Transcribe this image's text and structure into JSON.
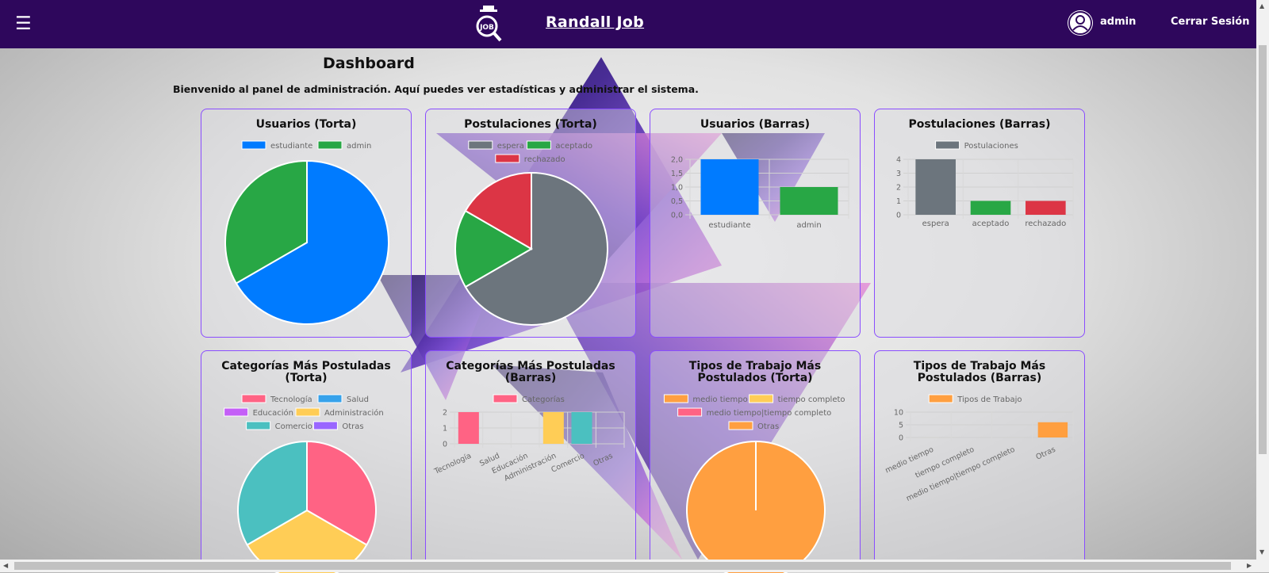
{
  "header": {
    "menu_glyph": "☰",
    "logo_text": "JOB",
    "brand": "Randall Job",
    "user": "admin",
    "logout": "Cerrar Sesión"
  },
  "page": {
    "title": "Dashboard",
    "welcome": "Bienvenido al panel de administración. Aquí puedes ver estadísticas y administrar el sistema."
  },
  "colors": {
    "nav": "#2e075c",
    "blue": "#007bff",
    "green": "#28a745",
    "gray": "#6c757d",
    "red": "#dc3545",
    "pink": "#ff6384",
    "skyblue": "#36a2eb",
    "purple": "#c45ff7",
    "yellow": "#ffcd56",
    "teal": "#4bc0c0",
    "violet": "#9966ff",
    "orange": "#ff9f40"
  },
  "chart_data": [
    {
      "id": "usuarios-torta",
      "title": "Usuarios (Torta)",
      "type": "pie",
      "categories": [
        "estudiante",
        "admin"
      ],
      "values": [
        2,
        1
      ],
      "colors": [
        "#007bff",
        "#28a745"
      ]
    },
    {
      "id": "postulaciones-torta",
      "title": "Postulaciones (Torta)",
      "type": "pie",
      "categories": [
        "espera",
        "aceptado",
        "rechazado"
      ],
      "values": [
        4,
        1,
        1
      ],
      "colors": [
        "#6c757d",
        "#28a745",
        "#dc3545"
      ]
    },
    {
      "id": "usuarios-barras",
      "title": "Usuarios (Barras)",
      "type": "bar",
      "categories": [
        "estudiante",
        "admin"
      ],
      "values": [
        2,
        1
      ],
      "colors": [
        "#007bff",
        "#28a745"
      ],
      "legend": "",
      "yticks": [
        "2,0",
        "1,5",
        "1,0",
        "0,5",
        "0,0"
      ],
      "ylim": [
        0,
        2
      ]
    },
    {
      "id": "postulaciones-barras",
      "title": "Postulaciones (Barras)",
      "type": "bar",
      "categories": [
        "espera",
        "aceptado",
        "rechazado"
      ],
      "values": [
        4,
        1,
        1
      ],
      "colors": [
        "#6c757d",
        "#28a745",
        "#dc3545"
      ],
      "legend": "Postulaciones",
      "yticks": [
        "4",
        "3",
        "2",
        "1",
        "0"
      ],
      "ylim": [
        0,
        4
      ]
    },
    {
      "id": "categorias-torta",
      "title": "Categorías Más Postuladas (Torta)",
      "type": "pie",
      "categories": [
        "Tecnología",
        "Salud",
        "Educación",
        "Administración",
        "Comercio",
        "Otras"
      ],
      "values": [
        2,
        0,
        0,
        2,
        2,
        0
      ],
      "colors": [
        "#ff6384",
        "#36a2eb",
        "#c45ff7",
        "#ffcd56",
        "#4bc0c0",
        "#9966ff"
      ]
    },
    {
      "id": "categorias-barras",
      "title": "Categorías Más Postuladas (Barras)",
      "type": "bar",
      "categories": [
        "Tecnología",
        "Salud",
        "Educación",
        "Administración",
        "Comercio",
        "Otras"
      ],
      "values": [
        2,
        0,
        0,
        2,
        2,
        0
      ],
      "colors": [
        "#ff6384",
        "#36a2eb",
        "#c45ff7",
        "#ffcd56",
        "#4bc0c0",
        "#9966ff"
      ],
      "legend": "Categorías",
      "yticks": [
        "2",
        "1",
        "0"
      ],
      "ylim": [
        0,
        2
      ]
    },
    {
      "id": "tipos-torta",
      "title": "Tipos de Trabajo Más Postulados (Torta)",
      "type": "pie",
      "categories": [
        "medio tiempo",
        "tiempo completo",
        "medio tiempo|tiempo completo",
        "Otras"
      ],
      "values": [
        0,
        0,
        0,
        6
      ],
      "colors": [
        "#ff9f40",
        "#ffcd56",
        "#ff6384",
        "#ff9f40"
      ]
    },
    {
      "id": "tipos-barras",
      "title": "Tipos de Trabajo Más Postulados (Barras)",
      "type": "bar",
      "categories": [
        "medio tiempo",
        "tiempo completo",
        "medio tiempo|tiempo completo",
        "Otras"
      ],
      "values": [
        0,
        0,
        0,
        6
      ],
      "colors": [
        "#ff9f40",
        "#ff9f40",
        "#ff9f40",
        "#ff9f40"
      ],
      "legend": "Tipos de Trabajo",
      "yticks": [
        "10",
        "5",
        "0"
      ],
      "ylim": [
        0,
        10
      ]
    }
  ]
}
